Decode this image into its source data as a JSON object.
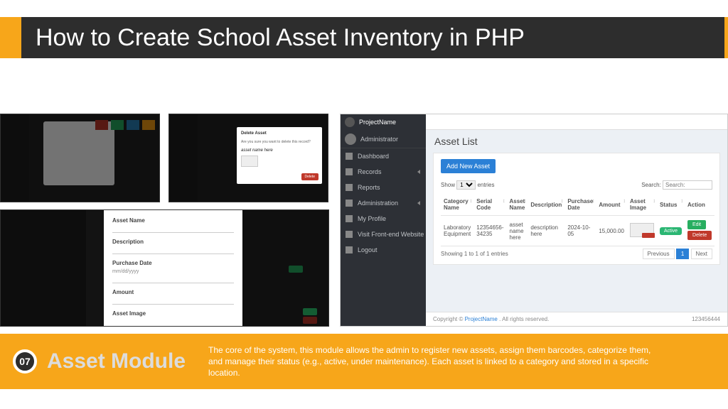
{
  "slide": {
    "title": "How to Create School Asset Inventory in PHP",
    "module_number": "07",
    "module_title": "Asset Module",
    "module_description": "The core of the system, this module allows the admin to register new assets, assign them barcodes, categorize them, and manage their status (e.g., active, under maintenance). Each asset is linked to a category and stored in a specific location."
  },
  "delete_modal": {
    "title": "Delete Asset",
    "prompt": "Are you sure you want to delete this record?",
    "asset_name": "asset name here",
    "confirm_label": "Delete"
  },
  "form": {
    "asset_name_label": "Asset Name",
    "description_label": "Description",
    "purchase_date_label": "Purchase Date",
    "purchase_date_placeholder": "mm/dd/yyyy",
    "amount_label": "Amount",
    "asset_image_label": "Asset Image"
  },
  "app": {
    "brand": "ProjectName",
    "user_role": "Administrator",
    "nav": [
      {
        "label": "Dashboard",
        "expandable": false
      },
      {
        "label": "Records",
        "expandable": true
      },
      {
        "label": "Reports",
        "expandable": false
      },
      {
        "label": "Administration",
        "expandable": true
      },
      {
        "label": "My Profile",
        "expandable": false
      },
      {
        "label": "Visit Front-end Website",
        "expandable": false
      },
      {
        "label": "Logout",
        "expandable": false
      }
    ],
    "page_title": "Asset List",
    "add_button": "Add New Asset",
    "table": {
      "length_prefix": "Show",
      "length_value": "1",
      "length_suffix": "entries",
      "search_label": "Search:",
      "columns": [
        "Category Name",
        "Serial Code",
        "Asset Name",
        "Description",
        "Purchase Date",
        "Amount",
        "Asset Image",
        "Status",
        "Action"
      ],
      "row": {
        "category": "Laboratory Equipment",
        "serial": "12354656-34235",
        "name": "asset name here",
        "description": "description here",
        "date": "2024-10-05",
        "amount": "15,000.00",
        "status": "Active",
        "edit": "Edit",
        "delete": "Delete"
      },
      "info": "Showing 1 to 1 of 1 entries",
      "prev": "Previous",
      "page": "1",
      "next": "Next"
    },
    "footer": {
      "copyright_prefix": "Copyright © ",
      "project": "ProjectName",
      "rights": ". All rights reserved.",
      "version": "123456444"
    }
  }
}
